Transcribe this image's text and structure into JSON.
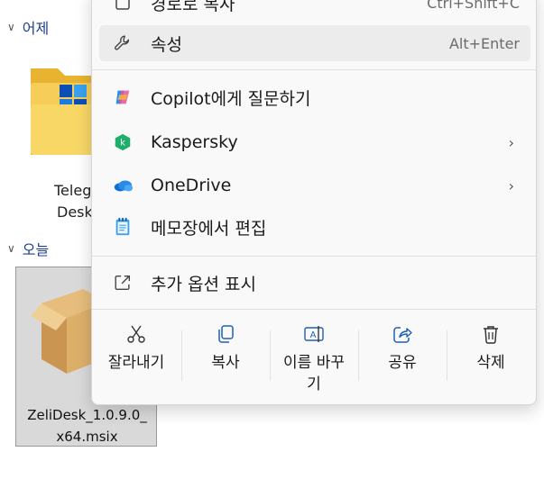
{
  "explorer": {
    "groups": [
      {
        "label": "어제"
      },
      {
        "label": "오늘"
      }
    ],
    "folder_item": {
      "label_line1": "Teleg",
      "label_line2": "Desk"
    },
    "selected_file": {
      "name_line1": "ZeliDesk_1.0.9.0_",
      "name_line2": "x64.msix"
    }
  },
  "context_menu": {
    "top_partial": {
      "label": "경로로 복사",
      "shortcut": "Ctrl+Shift+C"
    },
    "items": [
      {
        "label": "속성",
        "shortcut": "Alt+Enter",
        "icon": "wrench-icon"
      },
      {
        "label": "Copilot에게 질문하기",
        "icon": "copilot-icon"
      },
      {
        "label": "Kaspersky",
        "icon": "kaspersky-icon",
        "submenu": "›"
      },
      {
        "label": "OneDrive",
        "icon": "onedrive-icon",
        "submenu": "›"
      },
      {
        "label": "메모장에서 편집",
        "icon": "notepad-icon"
      },
      {
        "label": "추가 옵션 표시",
        "icon": "open-external-icon"
      }
    ],
    "command_bar": [
      {
        "label": "잘라내기",
        "icon": "scissors-icon"
      },
      {
        "label": "복사",
        "icon": "copy-icon"
      },
      {
        "label_line1": "이름 바꾸",
        "label_line2": "기",
        "icon": "rename-icon"
      },
      {
        "label": "공유",
        "icon": "share-icon"
      },
      {
        "label": "삭제",
        "icon": "trash-icon"
      }
    ]
  }
}
